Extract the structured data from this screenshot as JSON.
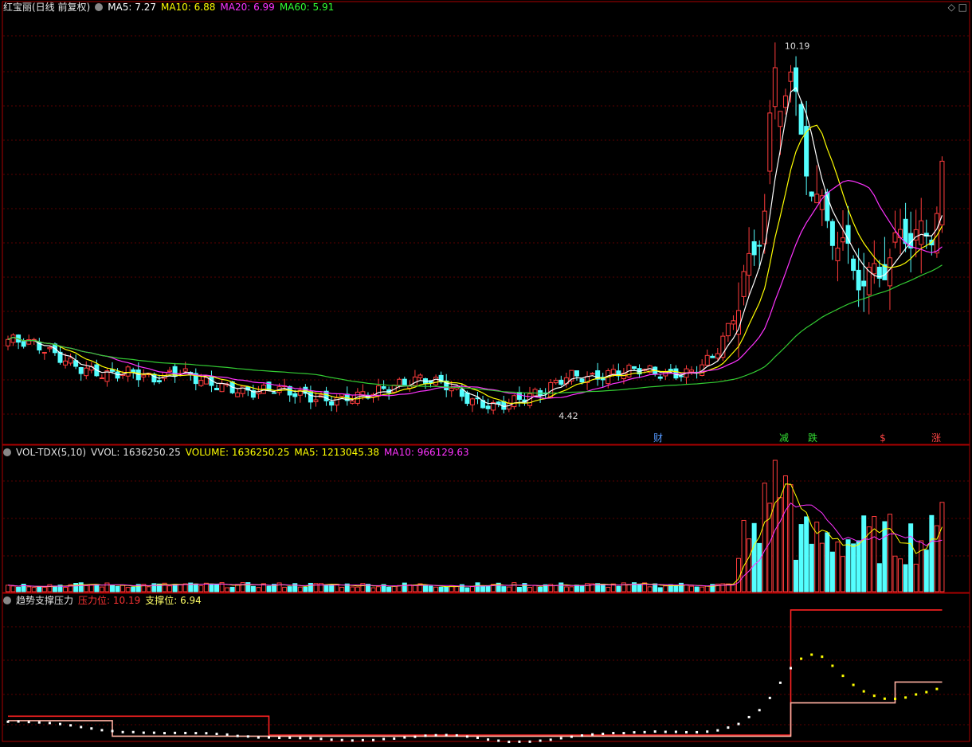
{
  "main_header": {
    "title": "红宝丽(日线 前复权)",
    "ma5": "MA5: 7.27",
    "ma10": "MA10: 6.88",
    "ma20": "MA20: 6.99",
    "ma60": "MA60: 5.91"
  },
  "vol_header": {
    "title": "VOL-TDX(5,10)",
    "vvol": "VVOL: 1636250.25",
    "volume": "VOLUME: 1636250.25",
    "ma5": "MA5: 1213045.38",
    "ma10": "MA10: 966129.63"
  },
  "ind_header": {
    "title": "趋势支撑压力",
    "pressure": "压力位: 10.19",
    "support": "支撑位: 6.94"
  },
  "colors": {
    "up": "#ff3c3c",
    "down": "#54ffff",
    "ma5": "#ffffff",
    "ma10": "#ffff00",
    "ma20": "#ff33ff",
    "ma60": "#33cc33",
    "grid": "#5a0000",
    "frame": "#aa0000"
  },
  "chart_data": [
    {
      "type": "candlestick",
      "title": "红宝丽(日线 前复权)",
      "ylim": [
        4.2,
        10.6
      ],
      "annotations": {
        "high": "10.19",
        "low": "4.42"
      },
      "event_markers": [
        "财",
        "减",
        "跌",
        "$",
        "涨"
      ],
      "series_names": [
        "MA5",
        "MA10",
        "MA20",
        "MA60"
      ],
      "ohlc_sample": [
        [
          5.55,
          5.75,
          5.3,
          5.6
        ],
        [
          5.85,
          5.9,
          5.5,
          5.55
        ],
        [
          5.5,
          5.55,
          5.3,
          5.35
        ],
        [
          5.2,
          5.3,
          5.1,
          5.15
        ],
        [
          5.1,
          5.2,
          5.0,
          5.05
        ],
        [
          5.05,
          5.12,
          4.95,
          5.1
        ],
        [
          5.0,
          5.1,
          4.92,
          4.98
        ],
        [
          5.08,
          5.18,
          5.0,
          5.12
        ],
        [
          5.0,
          5.05,
          4.9,
          4.95
        ],
        [
          4.9,
          4.98,
          4.8,
          4.85
        ],
        [
          4.85,
          4.92,
          4.72,
          4.78
        ],
        [
          4.8,
          4.9,
          4.75,
          4.85
        ],
        [
          4.8,
          4.88,
          4.7,
          4.75
        ],
        [
          4.72,
          4.8,
          4.6,
          4.65
        ],
        [
          4.65,
          4.75,
          4.55,
          4.7
        ],
        [
          4.7,
          4.82,
          4.62,
          4.78
        ],
        [
          4.8,
          4.95,
          4.72,
          4.9
        ],
        [
          4.9,
          5.05,
          4.85,
          5.0
        ],
        [
          5.0,
          5.1,
          4.85,
          4.9
        ],
        [
          4.85,
          4.9,
          4.6,
          4.65
        ],
        [
          4.6,
          4.7,
          4.42,
          4.55
        ],
        [
          4.55,
          4.72,
          4.5,
          4.68
        ],
        [
          4.7,
          4.85,
          4.65,
          4.8
        ],
        [
          4.85,
          5.1,
          4.8,
          5.05
        ],
        [
          5.1,
          5.25,
          4.95,
          5.0
        ],
        [
          5.0,
          5.15,
          4.95,
          5.1
        ],
        [
          5.12,
          5.25,
          5.05,
          5.15
        ],
        [
          5.15,
          5.2,
          5.0,
          5.05
        ],
        [
          5.05,
          5.1,
          4.95,
          5.08
        ],
        [
          5.1,
          5.4,
          5.05,
          5.35
        ],
        [
          5.4,
          6.2,
          5.35,
          6.1
        ],
        [
          6.15,
          7.0,
          6.1,
          6.9
        ],
        [
          6.95,
          7.6,
          6.85,
          7.5
        ],
        [
          7.55,
          9.3,
          7.5,
          9.1
        ],
        [
          9.2,
          10.19,
          9.0,
          9.8
        ],
        [
          9.6,
          9.8,
          8.4,
          8.6
        ],
        [
          8.5,
          8.7,
          7.6,
          7.8
        ],
        [
          7.7,
          7.9,
          7.2,
          7.4
        ],
        [
          7.3,
          7.5,
          7.0,
          7.1
        ],
        [
          7.0,
          7.3,
          6.6,
          6.7
        ],
        [
          6.8,
          6.95,
          6.4,
          6.5
        ],
        [
          6.5,
          6.7,
          6.4,
          6.6
        ],
        [
          6.7,
          7.0,
          6.6,
          6.95
        ],
        [
          7.0,
          7.6,
          6.9,
          7.2
        ],
        [
          7.2,
          7.4,
          6.9,
          7.3
        ],
        [
          7.3,
          7.5,
          6.9,
          7.0
        ],
        [
          7.0,
          8.4,
          6.95,
          8.3
        ]
      ]
    },
    {
      "type": "bar",
      "title": "VOL-TDX(5,10)",
      "series_names": [
        "VOLUME",
        "MA5",
        "MA10"
      ],
      "last_values": {
        "volume": 1636250.25,
        "ma5": 1213045.38,
        "ma10": 966129.63
      }
    },
    {
      "type": "line",
      "title": "趋势支撑压力",
      "series_names": [
        "压力位",
        "支撑位"
      ],
      "last_values": {
        "pressure": 10.19,
        "support": 6.94
      }
    }
  ]
}
